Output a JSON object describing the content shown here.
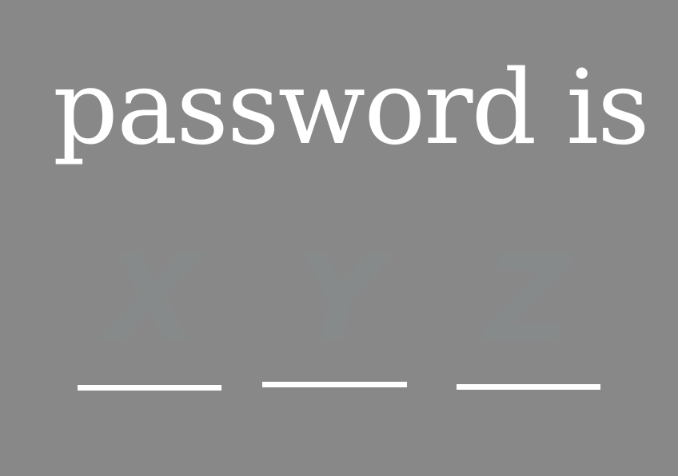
{
  "heading": "password is",
  "hidden_letters": [
    "X",
    "Y",
    "Z"
  ],
  "colors": {
    "background": "#888888",
    "text": "#ffffff",
    "hidden_letters": "#878a8a"
  }
}
